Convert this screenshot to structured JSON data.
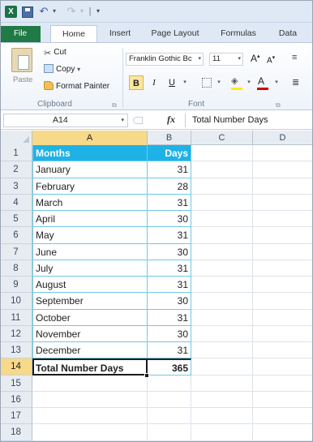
{
  "quick_access": {
    "app_icon": "X",
    "save_icon": "save-icon",
    "undo_icon": "undo-icon",
    "redo_icon": "redo-icon",
    "customize_icon": "customize-qat-icon"
  },
  "ribbon_tabs": [
    "File",
    "Home",
    "Insert",
    "Page Layout",
    "Formulas",
    "Data"
  ],
  "active_tab": "Home",
  "clipboard": {
    "paste": "Paste",
    "cut": "Cut",
    "copy": "Copy",
    "copy_arrow": "▾",
    "format_painter": "Format Painter",
    "group_label": "Clipboard",
    "launcher": "⧉"
  },
  "font": {
    "name": "Franklin Gothic Bc",
    "size": "11",
    "grow": "A",
    "shrink": "A",
    "bold": "B",
    "italic": "I",
    "underline": "U",
    "font_color_label": "A",
    "fill_icon": "⛏",
    "group_label": "Font",
    "fill_color": "#ffee00",
    "font_color": "#d40000"
  },
  "formula_bar": {
    "name_box": "A14",
    "fx": "fx",
    "content": "Total Number Days"
  },
  "grid": {
    "columns": [
      "A",
      "B",
      "C",
      "D"
    ],
    "selected_column": "A",
    "header_color": "#1fb2e6",
    "rows": [
      {
        "num": "1",
        "a": "Months",
        "b": "Days"
      },
      {
        "num": "2",
        "a": "January",
        "b": "31"
      },
      {
        "num": "3",
        "a": "February",
        "b": "28"
      },
      {
        "num": "4",
        "a": "March",
        "b": "31"
      },
      {
        "num": "5",
        "a": "April",
        "b": "30"
      },
      {
        "num": "6",
        "a": "May",
        "b": "31"
      },
      {
        "num": "7",
        "a": "June",
        "b": "30"
      },
      {
        "num": "8",
        "a": "July",
        "b": "31"
      },
      {
        "num": "9",
        "a": "August",
        "b": "31"
      },
      {
        "num": "10",
        "a": "September",
        "b": "30"
      },
      {
        "num": "11",
        "a": "October",
        "b": "31"
      },
      {
        "num": "12",
        "a": "November",
        "b": "30"
      },
      {
        "num": "13",
        "a": "December",
        "b": "31"
      },
      {
        "num": "14",
        "a": "Total Number Days",
        "b": "365"
      },
      {
        "num": "15",
        "a": "",
        "b": ""
      },
      {
        "num": "16",
        "a": "",
        "b": ""
      },
      {
        "num": "17",
        "a": "",
        "b": ""
      },
      {
        "num": "18",
        "a": "",
        "b": ""
      }
    ],
    "active_row": "14"
  }
}
